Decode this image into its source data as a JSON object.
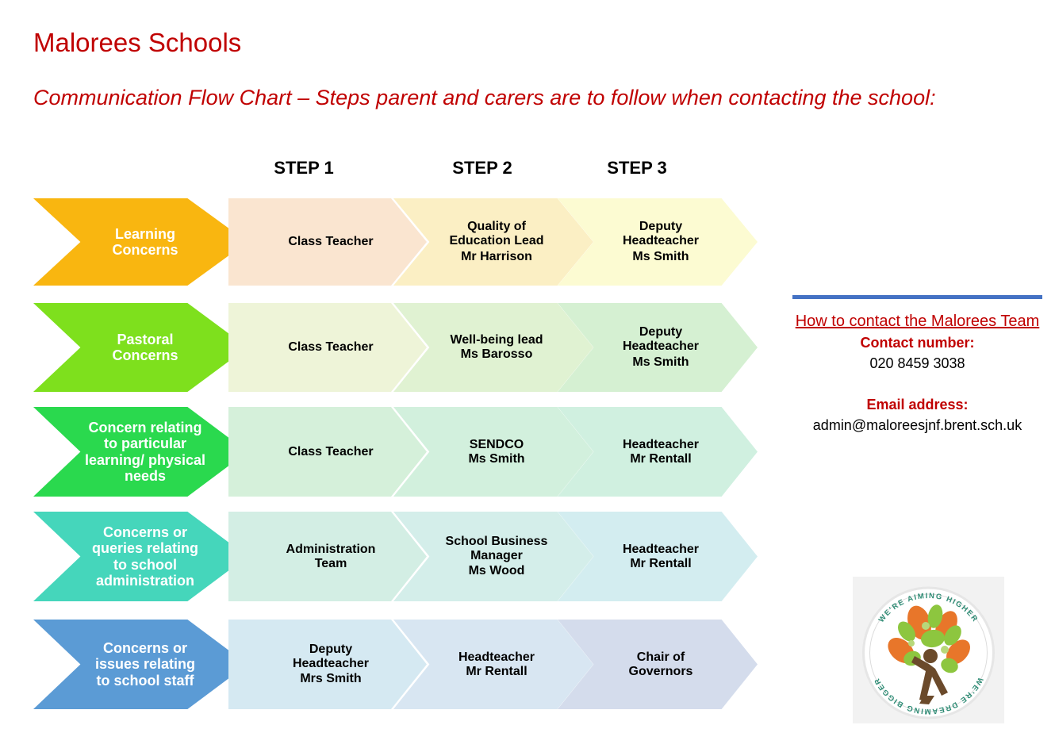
{
  "header": {
    "title": "Malorees Schools",
    "subtitle": "Communication Flow Chart – Steps parent and carers are to follow when contacting the school:"
  },
  "flow": {
    "step_headers": [
      "STEP 1",
      "STEP 2",
      "STEP 3"
    ],
    "rows": [
      {
        "category": "Learning Concerns",
        "category_lines": [
          "Learning",
          "Concerns"
        ],
        "category_color": "#f9b610",
        "steps": [
          {
            "lines": [
              "Class Teacher"
            ],
            "color": "#fae5d0"
          },
          {
            "lines": [
              "Quality of",
              "Education Lead",
              "Mr Harrison"
            ],
            "color": "#fbefc4"
          },
          {
            "lines": [
              "Deputy",
              "Headteacher",
              "Ms Smith"
            ],
            "color": "#fcfbd2"
          }
        ]
      },
      {
        "category": "Pastoral Concerns",
        "category_lines": [
          "Pastoral",
          "Concerns"
        ],
        "category_color": "#7ee01d",
        "steps": [
          {
            "lines": [
              "Class Teacher"
            ],
            "color": "#eef4d8"
          },
          {
            "lines": [
              "Well-being lead",
              "Ms Barosso"
            ],
            "color": "#e0f2d2"
          },
          {
            "lines": [
              "Deputy",
              "Headteacher",
              "Ms Smith"
            ],
            "color": "#d5f0d2"
          }
        ]
      },
      {
        "category": "Concern relating to particular learning/ physical needs",
        "category_lines": [
          "Concern relating",
          "to particular",
          "learning/ physical",
          "needs"
        ],
        "category_color": "#2ad94e",
        "steps": [
          {
            "lines": [
              "Class Teacher"
            ],
            "color": "#d5f0da"
          },
          {
            "lines": [
              "SENDCO",
              "Ms Smith"
            ],
            "color": "#d2f0dd"
          },
          {
            "lines": [
              "Headteacher",
              "Mr Rentall"
            ],
            "color": "#d0f0e0"
          }
        ]
      },
      {
        "category": "Concerns or queries relating to school administration",
        "category_lines": [
          "Concerns or",
          "queries relating",
          "to school",
          "administration"
        ],
        "category_color": "#45d6bb",
        "steps": [
          {
            "lines": [
              "Administration",
              "Team"
            ],
            "color": "#d3eee4"
          },
          {
            "lines": [
              "School Business",
              "Manager",
              "Ms Wood"
            ],
            "color": "#d4eeea"
          },
          {
            "lines": [
              "Headteacher",
              "Mr Rentall"
            ],
            "color": "#d3edf0"
          }
        ]
      },
      {
        "category": "Concerns or issues relating to school staff",
        "category_lines": [
          "Concerns or",
          "issues relating",
          "to school staff"
        ],
        "category_color": "#5b9bd5",
        "steps": [
          {
            "lines": [
              "Deputy",
              "Headteacher",
              "Mrs Smith"
            ],
            "color": "#d5e9f2"
          },
          {
            "lines": [
              "Headteacher",
              "Mr Rentall"
            ],
            "color": "#d8e6f2"
          },
          {
            "lines": [
              "Chair of",
              "Governors"
            ],
            "color": "#d4dcec"
          }
        ]
      }
    ]
  },
  "contact": {
    "accent_color": "#4472c4",
    "heading": "How to contact the Malorees Team",
    "phone_label": "Contact number:",
    "phone_value": "020 8459 3038",
    "email_label": "Email address:",
    "email_value": "admin@maloreesjnf.brent.sch.uk"
  },
  "logo": {
    "name": "malorees-school-crest-logo",
    "motto": "WE'RE AIMING HIGHER · WE'RE DREAMING BIGGER"
  }
}
